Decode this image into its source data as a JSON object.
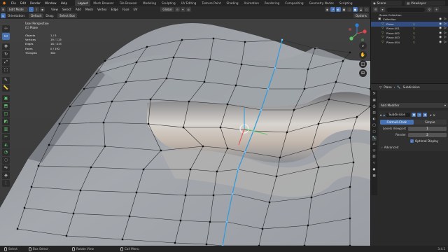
{
  "app": {
    "logo_glyph": "◆",
    "menus": [
      "File",
      "Edit",
      "Render",
      "Window",
      "Help"
    ],
    "workspace_tabs": [
      "Layout",
      "Mesh Browser",
      "File Browser",
      "Modeling",
      "Sculpting",
      "UV Editing",
      "Texture Paint",
      "Shading",
      "Animation",
      "Rendering",
      "Compositing",
      "Geometry Nodes",
      "Scripting"
    ],
    "active_tab": "Layout",
    "scene_name": "Scene",
    "view_layer": "ViewLayer"
  },
  "viewport_header": {
    "mode": "Edit Mode",
    "menus": [
      "View",
      "Select",
      "Add",
      "Mesh",
      "Vertex",
      "Edge",
      "Face",
      "UV"
    ],
    "transform_orientation": "Global",
    "options_label": "Options"
  },
  "tool_header": {
    "orientation_label": "Orientation:",
    "orientation_value": "Default",
    "drag_label": "Drag:",
    "drag_value": "Select Box"
  },
  "overlay": {
    "view_name": "User Perspective",
    "object_name": "(1) Plane",
    "stats": [
      {
        "label": "Objects",
        "value": "1 / 5"
      },
      {
        "label": "Vertices",
        "value": "19 / 115"
      },
      {
        "label": "Edges",
        "value": "18 / 415"
      },
      {
        "label": "Faces",
        "value": "0 / 192"
      },
      {
        "label": "Triangles",
        "value": "384"
      }
    ]
  },
  "toolbar": [
    "cursor",
    "select",
    "move",
    "rotate",
    "scale",
    "transform",
    "annotate",
    "measure",
    "add-cube",
    "extrude",
    "inset",
    "bevel",
    "loop-cut",
    "knife",
    "poly-build",
    "spin",
    "smooth",
    "edge-slide",
    "shrink",
    "shear",
    "rip"
  ],
  "statusbar": {
    "items": [
      "Select",
      "Box Select",
      "Rotate View",
      "Call Menu"
    ],
    "version": "3.4.1"
  },
  "outliner": {
    "root": "Scene Collection",
    "collection": "Collection",
    "items": [
      "Plane",
      "Plane.001",
      "Plane.002",
      "Plane.003",
      "Plane.004"
    ],
    "selected": "Plane"
  },
  "properties": {
    "breadcrumb_object": "Plane",
    "breadcrumb_section": "Subdivision",
    "add_modifier": "Add Modifier",
    "modifier_name": "Subdivision",
    "algorithms": [
      "Catmull-Clark",
      "Simple"
    ],
    "active_algorithm": "Catmull-Clark",
    "levels_viewport_label": "Levels Viewport",
    "levels_viewport": "1",
    "render_label": "Render",
    "render": "2",
    "optimal_display_label": "Optimal Display",
    "optimal_display": true,
    "advanced_label": "Advanced"
  },
  "colors": {
    "accent": "#4772b3",
    "selected_edge": "#2f9bdc",
    "logo": "#e87d0d"
  }
}
